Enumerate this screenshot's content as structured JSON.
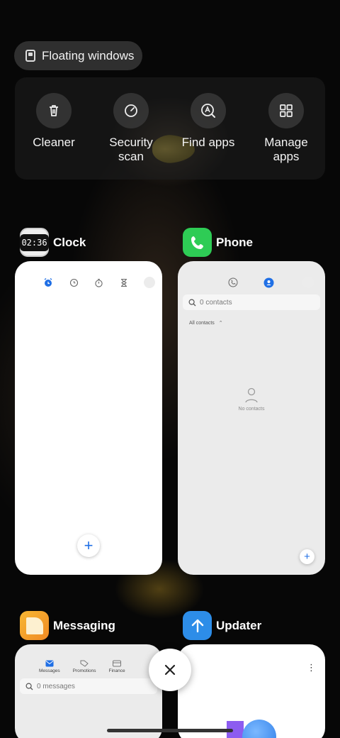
{
  "floating_windows": {
    "label": "Floating windows",
    "icon": "floating-window-icon"
  },
  "quick_actions": [
    {
      "label": "Cleaner",
      "icon": "trash-icon"
    },
    {
      "label": "Security\nscan",
      "icon": "security-scan-icon"
    },
    {
      "label": "Find apps",
      "icon": "find-apps-icon"
    },
    {
      "label": "Manage\napps",
      "icon": "grid-icon"
    }
  ],
  "apps": {
    "clock": {
      "name": "Clock",
      "icon_text": "02:36",
      "fab": "+"
    },
    "phone": {
      "name": "Phone",
      "search_placeholder": "0 contacts",
      "filter": "All contacts",
      "empty": "No contacts",
      "fab": "+"
    },
    "messaging": {
      "name": "Messaging",
      "tabs": [
        "Messages",
        "Promotions",
        "Finance"
      ],
      "search_placeholder": "0 messages"
    },
    "updater": {
      "name": "Updater"
    }
  },
  "colors": {
    "accent": "#1f6fe5",
    "phone_green": "#2ecc55",
    "messaging_orange": "#f5a623",
    "updater_blue": "#2d8de8"
  }
}
